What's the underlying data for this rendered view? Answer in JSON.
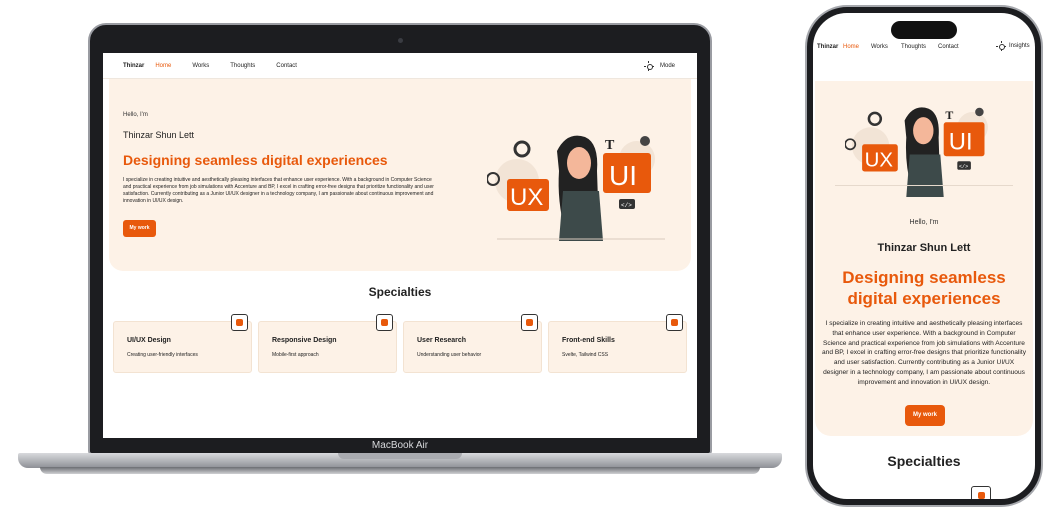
{
  "desktop": {
    "device_label": "MacBook Air",
    "nav": {
      "brand": "Thinzar",
      "links": [
        "Home",
        "Works",
        "Thoughts",
        "Contact"
      ],
      "active": "Home",
      "mode_label": "Mode"
    },
    "hero": {
      "greeting": "Hello, I'm",
      "name": "Thinzar Shun Lett",
      "headline": "Designing seamless digital experiences",
      "description": "I specialize in creating intuitive and aesthetically pleasing interfaces that enhance user experience. With a background in Computer Science and practical experience from job simulations with Accenture and BP, I excel in crafting error-free designs that prioritize functionality and user satisfaction. Currently contributing as a Junior UI/UX designer in a technology company, I am passionate about continuous improvement and innovation in UI/UX design.",
      "cta": "My work"
    },
    "specialties": {
      "title": "Specialties",
      "cards": [
        {
          "title": "UI/UX Design",
          "subtitle": "Creating user-friendly interfaces",
          "icon": "pencil-icon"
        },
        {
          "title": "Responsive Design",
          "subtitle": "Mobile-first approach",
          "icon": "mobile-icon"
        },
        {
          "title": "User Research",
          "subtitle": "Understanding user behavior",
          "icon": "search-icon"
        },
        {
          "title": "Front-end Skills",
          "subtitle": "Svelte, Tailwind CSS",
          "icon": "lightning-icon"
        }
      ]
    }
  },
  "mobile": {
    "nav": {
      "brand": "Thinzar",
      "links": [
        "Home",
        "Works",
        "Thoughts",
        "Contact"
      ],
      "active": "Home",
      "mode_label": "Insights"
    },
    "hero": {
      "greeting": "Hello, I'm",
      "name": "Thinzar Shun Lett",
      "headline": "Designing seamless digital experiences",
      "description": "I specialize in creating intuitive and aesthetically pleasing interfaces that enhance user experience. With a background in Computer Science and practical experience from job simulations with Accenture and BP, I excel in crafting error-free designs that prioritize functionality and user satisfaction. Currently contributing as a Junior UI/UX designer in a technology company, I am passionate about continuous improvement and innovation in UI/UX design.",
      "cta": "My work"
    },
    "specialties_title": "Specialties"
  },
  "illustration": {
    "ux_label": "UX",
    "ui_label": "UI",
    "t_label": "T",
    "code_label": "</>"
  },
  "colors": {
    "accent": "#e8590c",
    "hero_bg": "#fdf2e7",
    "device": "#1c1d20"
  }
}
